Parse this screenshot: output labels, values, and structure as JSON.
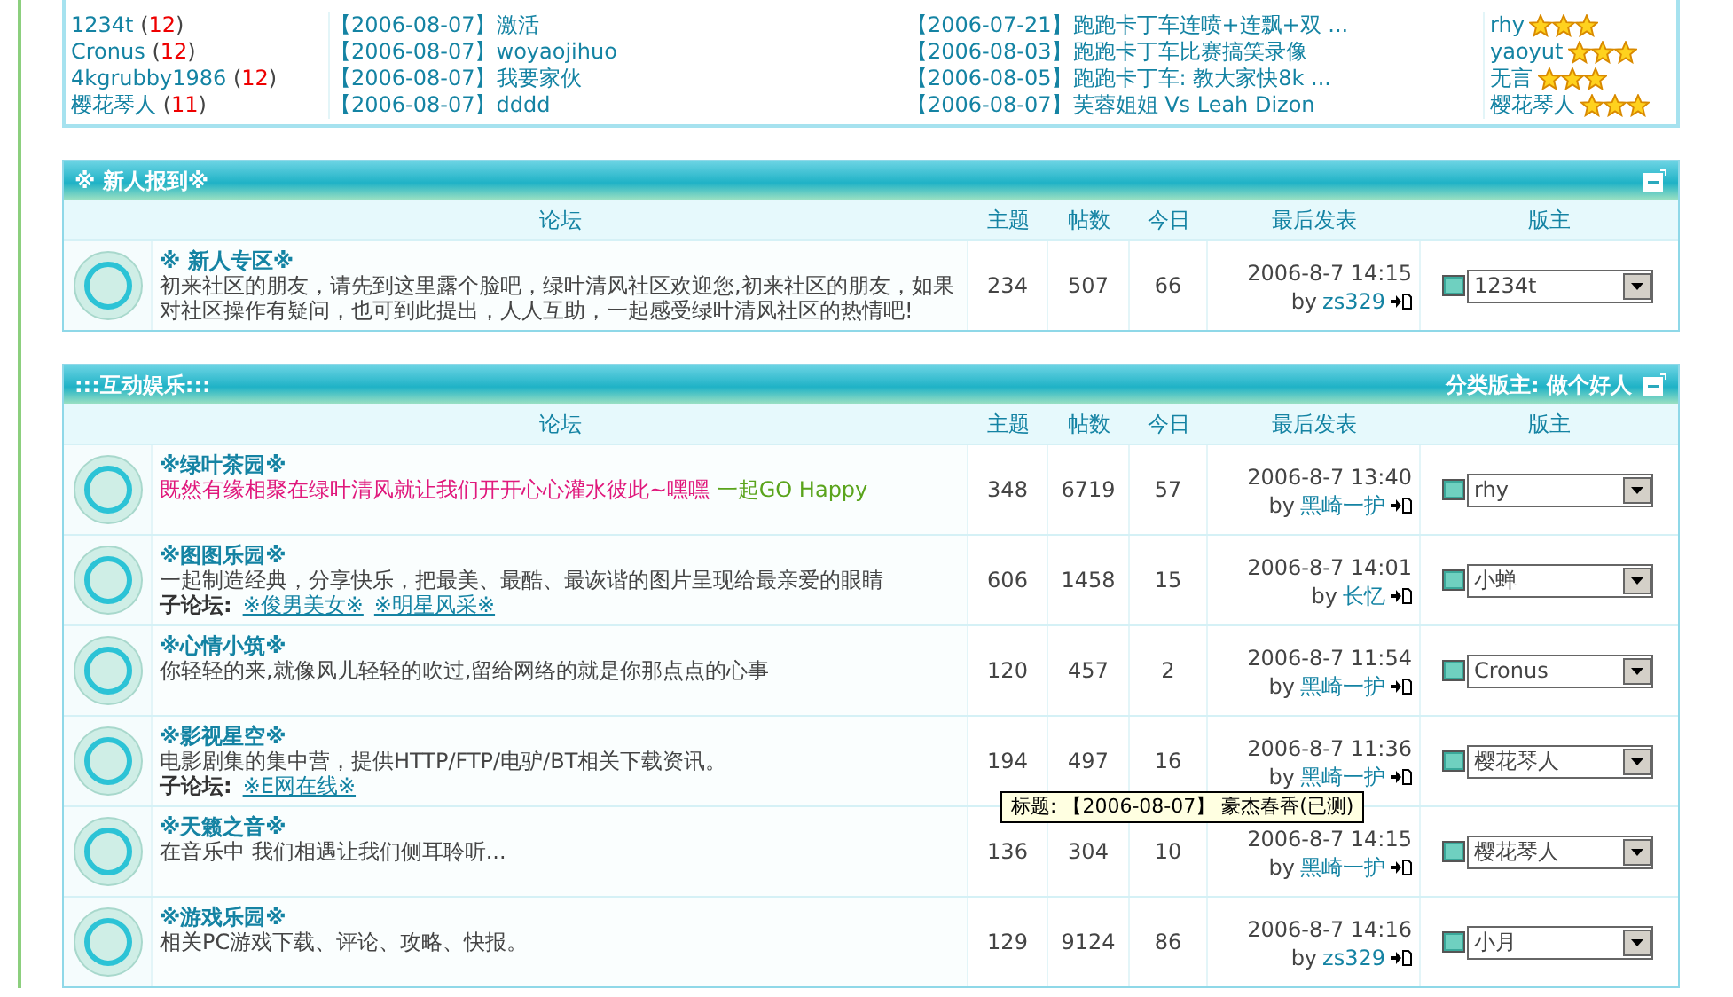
{
  "top_panel": {
    "rows": [
      {
        "user": "1234t",
        "count_open": "(",
        "count": "12",
        "count_close": ")",
        "date1": "【2006-08-07】",
        "title1": "激活",
        "date2": "【2006-07-21】",
        "title2": "跑跑卡丁车连喷+连飘+双 ...",
        "star_user": "rhy",
        "stars": 3
      },
      {
        "user": "Cronus",
        "count_open": "(",
        "count": "12",
        "count_close": ")",
        "date1": "【2006-08-07】",
        "title1": "woyaojihuo",
        "date2": "【2006-08-03】",
        "title2": "跑跑卡丁车比赛搞笑录像",
        "star_user": "yaoyut",
        "stars": 3
      },
      {
        "user": "4kgrubby1986",
        "count_open": "(",
        "count": "12",
        "count_close": ")",
        "date1": "【2006-08-07】",
        "title1": "我要家伙",
        "date2": "【2006-08-05】",
        "title2": "跑跑卡丁车: 教大家快8k ...",
        "star_user": "无言",
        "stars": 3
      },
      {
        "user": "樱花琴人",
        "count_open": "(",
        "count": "11",
        "count_close": ")",
        "date1": "【2006-08-07】",
        "title1": "dddd",
        "date2": "【2006-08-07】",
        "title2": "芙蓉姐姐 Vs Leah Dizon",
        "star_user": "樱花琴人",
        "stars": 3
      }
    ]
  },
  "sections": [
    {
      "title": "※ 新人报到※",
      "columns": [
        "论坛",
        "主题",
        "帖数",
        "今日",
        "最后发表",
        "版主"
      ],
      "forums": [
        {
          "name": "※ 新人专区※",
          "desc": [
            {
              "text": "初来社区的朋友，请先到这里露个脸吧，绿叶清风社区欢迎您,初来社区的朋友，如果对社区操作有疑问，也可到此提出，人人互助，一起感受绿叶清风社区的热情吧!",
              "color": "#444444"
            }
          ],
          "topics": "234",
          "posts": "507",
          "today": "66",
          "last_time": "2006-8-7 14:15",
          "by": "by",
          "last_user": "zs329",
          "moderator": "1234t"
        }
      ]
    },
    {
      "title": ":::互动娱乐:::",
      "moderator_label": "分类版主: 做个好人",
      "columns": [
        "论坛",
        "主题",
        "帖数",
        "今日",
        "最后发表",
        "版主"
      ],
      "forums": [
        {
          "name": "※绿叶茶园※",
          "desc": [
            {
              "text": "既然有缘相聚在绿叶清风就让我们开开心心灌水彼此~嘿嘿",
              "color": "#e0187c"
            },
            {
              "text": " 一起GO Happy",
              "color": "#5aa41c"
            }
          ],
          "topics": "348",
          "posts": "6719",
          "today": "57",
          "last_time": "2006-8-7 13:40",
          "by": "by",
          "last_user": "黑崎一护",
          "moderator": "rhy"
        },
        {
          "name": "※图图乐园※",
          "desc": [
            {
              "text": "一起制造经典，分享快乐，把最美、最酷、最诙谐的图片呈现给最亲爱的眼睛",
              "color": "#444444"
            }
          ],
          "sub_label": "子论坛:",
          "subs": [
            "※俊男美女※",
            "※明星风采※"
          ],
          "topics": "606",
          "posts": "1458",
          "today": "15",
          "last_time": "2006-8-7 14:01",
          "by": "by",
          "last_user": "长忆",
          "moderator": "小蝉"
        },
        {
          "name": "※心情小筑※",
          "desc": [
            {
              "text": "你轻轻的来,就像风儿轻轻的吹过,留给网络的就是你那点点的心事",
              "color": "#444444"
            }
          ],
          "topics": "120",
          "posts": "457",
          "today": "2",
          "last_time": "2006-8-7 11:54",
          "by": "by",
          "last_user": "黑崎一护",
          "moderator": "Cronus"
        },
        {
          "name": "※影视星空※",
          "desc": [
            {
              "text": "电影剧集的集中营，提供HTTP/FTP/电驴/BT相关下载资讯。",
              "color": "#444444"
            }
          ],
          "sub_label": "子论坛:",
          "subs": [
            "※E网在线※"
          ],
          "topics": "194",
          "posts": "497",
          "today": "16",
          "last_time": "2006-8-7 11:36",
          "by": "by",
          "last_user": "黑崎一护",
          "moderator": "樱花琴人",
          "tooltip": "标题: 【2006-08-07】 豪杰春香(已测)"
        },
        {
          "name": "※天籁之音※",
          "desc": [
            {
              "text": "在音乐中 我们相遇让我们侧耳聆听...",
              "color": "#444444"
            }
          ],
          "topics": "136",
          "posts": "304",
          "today": "10",
          "last_time": "2006-8-7 14:15",
          "by": "by",
          "last_user": "黑崎一护",
          "moderator": "樱花琴人"
        },
        {
          "name": "※游戏乐园※",
          "desc": [
            {
              "text": "相关PC游戏下载、评论、攻略、快报。",
              "color": "#444444"
            }
          ],
          "topics": "129",
          "posts": "9124",
          "today": "86",
          "last_time": "2006-8-7 14:16",
          "by": "by",
          "last_user": "zs329",
          "moderator": "小月"
        }
      ]
    }
  ]
}
